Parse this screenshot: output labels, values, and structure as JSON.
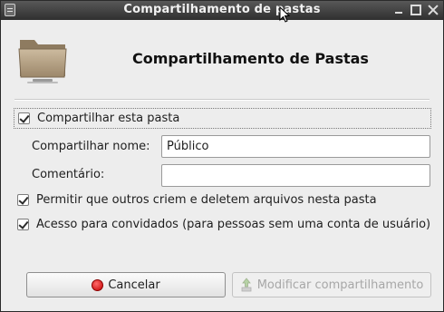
{
  "window": {
    "title": "Compartilhamento de pastas"
  },
  "header": {
    "title": "Compartilhamento de Pastas",
    "icon": "folder-icon"
  },
  "share": {
    "checkbox_label": "Compartilhar esta pasta",
    "checked": true
  },
  "fields": {
    "name_label": "Compartilhar nome:",
    "name_value": "Público",
    "comment_label": "Comentário:",
    "comment_value": ""
  },
  "options": {
    "allow_write_label": "Permitir que outros criem e deletem arquivos nesta pasta",
    "allow_write_checked": true,
    "guest_label": "Acesso para convidados (para pessoas sem uma conta de usuário)",
    "guest_checked": true
  },
  "buttons": {
    "cancel_label": "Cancelar",
    "modify_label": "Modificar compartilhamento",
    "cancel_icon": "stop-icon",
    "modify_icon": "share-icon"
  }
}
